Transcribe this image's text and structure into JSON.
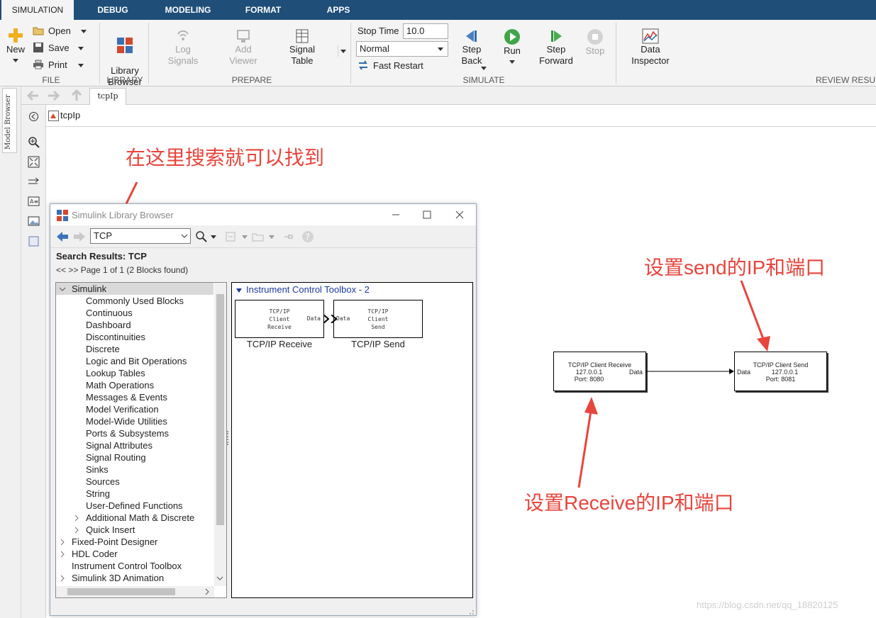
{
  "tabs": [
    {
      "label": "SIMULATION",
      "active": true
    },
    {
      "label": "DEBUG"
    },
    {
      "label": "MODELING"
    },
    {
      "label": "FORMAT"
    },
    {
      "label": "APPS"
    }
  ],
  "ribbon": {
    "file": {
      "new_label": "New",
      "open_label": "Open",
      "save_label": "Save",
      "print_label": "Print",
      "section": "FILE"
    },
    "library": {
      "library_browser_label": "Library\nBrowser",
      "section": "LIBRARY"
    },
    "prepare": {
      "log_signals_label": "Log\nSignals",
      "add_viewer_label": "Add\nViewer",
      "signal_table_label": "Signal\nTable",
      "section": "PREPARE"
    },
    "simulate": {
      "stop_time_label": "Stop Time",
      "stop_time_value": "10.0",
      "mode_value": "Normal",
      "fast_restart_label": "Fast Restart",
      "step_back_label": "Step\nBack",
      "run_label": "Run",
      "step_forward_label": "Step\nForward",
      "stop_label": "Stop",
      "section": "SIMULATE"
    },
    "review": {
      "data_inspector_label": "Data\nInspector",
      "section": "REVIEW RESU"
    }
  },
  "side_panel": {
    "model_browser_label": "Model Browser"
  },
  "editor": {
    "doc_tab": "tcpIp",
    "breadcrumb": "tcpIp"
  },
  "model": {
    "receive_block": {
      "title": "TCP/IP Client Receive",
      "ip": "127.0.0.1",
      "port": "Port: 8080",
      "out_port": "Data"
    },
    "send_block": {
      "title": "TCP/IP Client Send",
      "ip": "127.0.0.1",
      "port": "Port: 8081",
      "in_port": "Data"
    }
  },
  "library_browser": {
    "title": "Simulink Library Browser",
    "search_value": "TCP",
    "results_heading": "Search Results: TCP",
    "pager": "<< >> Page 1 of 1 (2 Blocks found)",
    "tree": [
      {
        "label": "Simulink",
        "level": 0,
        "expanded": true,
        "selected": true
      },
      {
        "label": "Commonly Used Blocks",
        "level": 1
      },
      {
        "label": "Continuous",
        "level": 1
      },
      {
        "label": "Dashboard",
        "level": 1
      },
      {
        "label": "Discontinuities",
        "level": 1
      },
      {
        "label": "Discrete",
        "level": 1
      },
      {
        "label": "Logic and Bit Operations",
        "level": 1
      },
      {
        "label": "Lookup Tables",
        "level": 1
      },
      {
        "label": "Math Operations",
        "level": 1
      },
      {
        "label": "Messages & Events",
        "level": 1
      },
      {
        "label": "Model Verification",
        "level": 1
      },
      {
        "label": "Model-Wide Utilities",
        "level": 1
      },
      {
        "label": "Ports & Subsystems",
        "level": 1
      },
      {
        "label": "Signal Attributes",
        "level": 1
      },
      {
        "label": "Signal Routing",
        "level": 1
      },
      {
        "label": "Sinks",
        "level": 1
      },
      {
        "label": "Sources",
        "level": 1
      },
      {
        "label": "String",
        "level": 1
      },
      {
        "label": "User-Defined Functions",
        "level": 1
      },
      {
        "label": "Additional Math & Discrete",
        "level": 1,
        "collapsed": true
      },
      {
        "label": "Quick Insert",
        "level": 1,
        "collapsed": true
      },
      {
        "label": "Fixed-Point Designer",
        "level": 0,
        "collapsed": true
      },
      {
        "label": "HDL Coder",
        "level": 0,
        "collapsed": true
      },
      {
        "label": "Instrument Control Toolbox",
        "level": 0
      },
      {
        "label": "Simulink 3D Animation",
        "level": 0,
        "collapsed": true
      }
    ],
    "group_label": "Instrument Control Toolbox - 2",
    "result_blocks": [
      {
        "line1": "TCP/IP",
        "line2": "Client",
        "line3": "Receive",
        "port": "Data",
        "caption": "TCP/IP Receive"
      },
      {
        "line1": "TCP/IP",
        "line2": "Client",
        "line3": "Send",
        "port": "Data",
        "caption": "TCP/IP Send"
      }
    ]
  },
  "annotations": {
    "search_hint": "在这里搜索就可以找到",
    "send_hint": "设置send的IP和端口",
    "receive_hint": "设置Receive的IP和端口"
  },
  "watermark": "https://blog.csdn.net/qq_18820125",
  "colors": {
    "tabbar": "#1f4e79",
    "annotation": "#e8453c",
    "group_label": "#1a3a9c"
  }
}
